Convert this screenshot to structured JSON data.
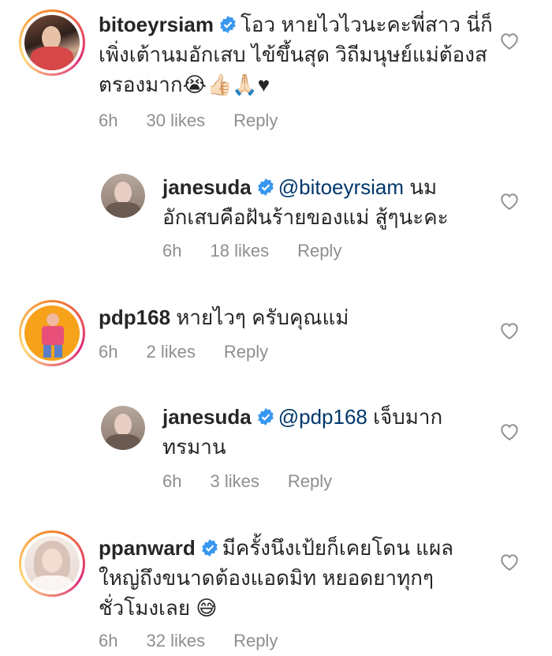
{
  "comments": [
    {
      "username": "bitoeyrsiam",
      "text": "โอว หายไวไวนะคะพี่สาว นี่ก็เพิ่งเต้านมอักเสบ ไข้ขึ้นสุด วิถีมนุษย์แม่ต้องสตรองมาก😭👍🏻🙏🏻♥",
      "time": "6h",
      "likes": "30 likes",
      "reply": "Reply"
    },
    {
      "username": "janesuda",
      "mention": "@bitoeyrsiam",
      "text": " นม อักเสบคือฝันร้ายของแม่ สู้ๆนะคะ",
      "time": "6h",
      "likes": "18 likes",
      "reply": "Reply"
    },
    {
      "username": "pdp168",
      "text": "หายไวๆ ครับคุณแม่",
      "time": "6h",
      "likes": "2 likes",
      "reply": "Reply"
    },
    {
      "username": "janesuda",
      "mention": "@pdp168",
      "text": " เจ็บมาก ทรมาน",
      "time": "6h",
      "likes": "3 likes",
      "reply": "Reply"
    },
    {
      "username": "ppanward",
      "text": "มีครั้งนึงเป้ยก็เคยโดน แผลใหญ่ถึงขนาดต้องแอดมิท หยอดยาทุกๆ ชั่วโมงเลย 😅",
      "time": "6h",
      "likes": "32 likes",
      "reply": "Reply"
    }
  ],
  "colors": {
    "text": "#262626",
    "meta": "#8e8e8e",
    "verified": "#3897f0",
    "mention": "#00376b"
  },
  "icons": {
    "verified": "verified-badge-icon",
    "like": "heart-outline-icon"
  }
}
